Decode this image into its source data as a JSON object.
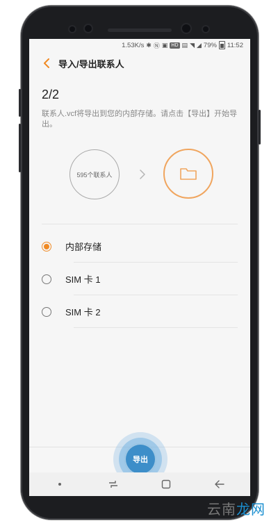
{
  "status_bar": {
    "speed": "1.53K/s",
    "hd_badge": "HD",
    "battery": "79%",
    "time": "11:52"
  },
  "app_bar": {
    "title": "导入/导出联系人"
  },
  "content": {
    "step": "2/2",
    "description": "联系人.vcf将导出到您的内部存储。请点击【导出】开始导出。",
    "contacts_count_label": "595个联系人"
  },
  "options": [
    {
      "label": "内部存储",
      "selected": true
    },
    {
      "label": "SIM 卡 1",
      "selected": false
    },
    {
      "label": "SIM 卡 2",
      "selected": false
    }
  ],
  "export_button": {
    "label": "导出"
  },
  "watermark": {
    "part1": "云南",
    "part2": "龙网"
  },
  "colors": {
    "accent": "#f08a24",
    "folder_ring": "#f0a55e",
    "export_blue": "#3d8ec9"
  },
  "icons": {
    "back": "chevron-left-icon",
    "arrow": "chevron-right-icon",
    "folder": "folder-icon"
  }
}
